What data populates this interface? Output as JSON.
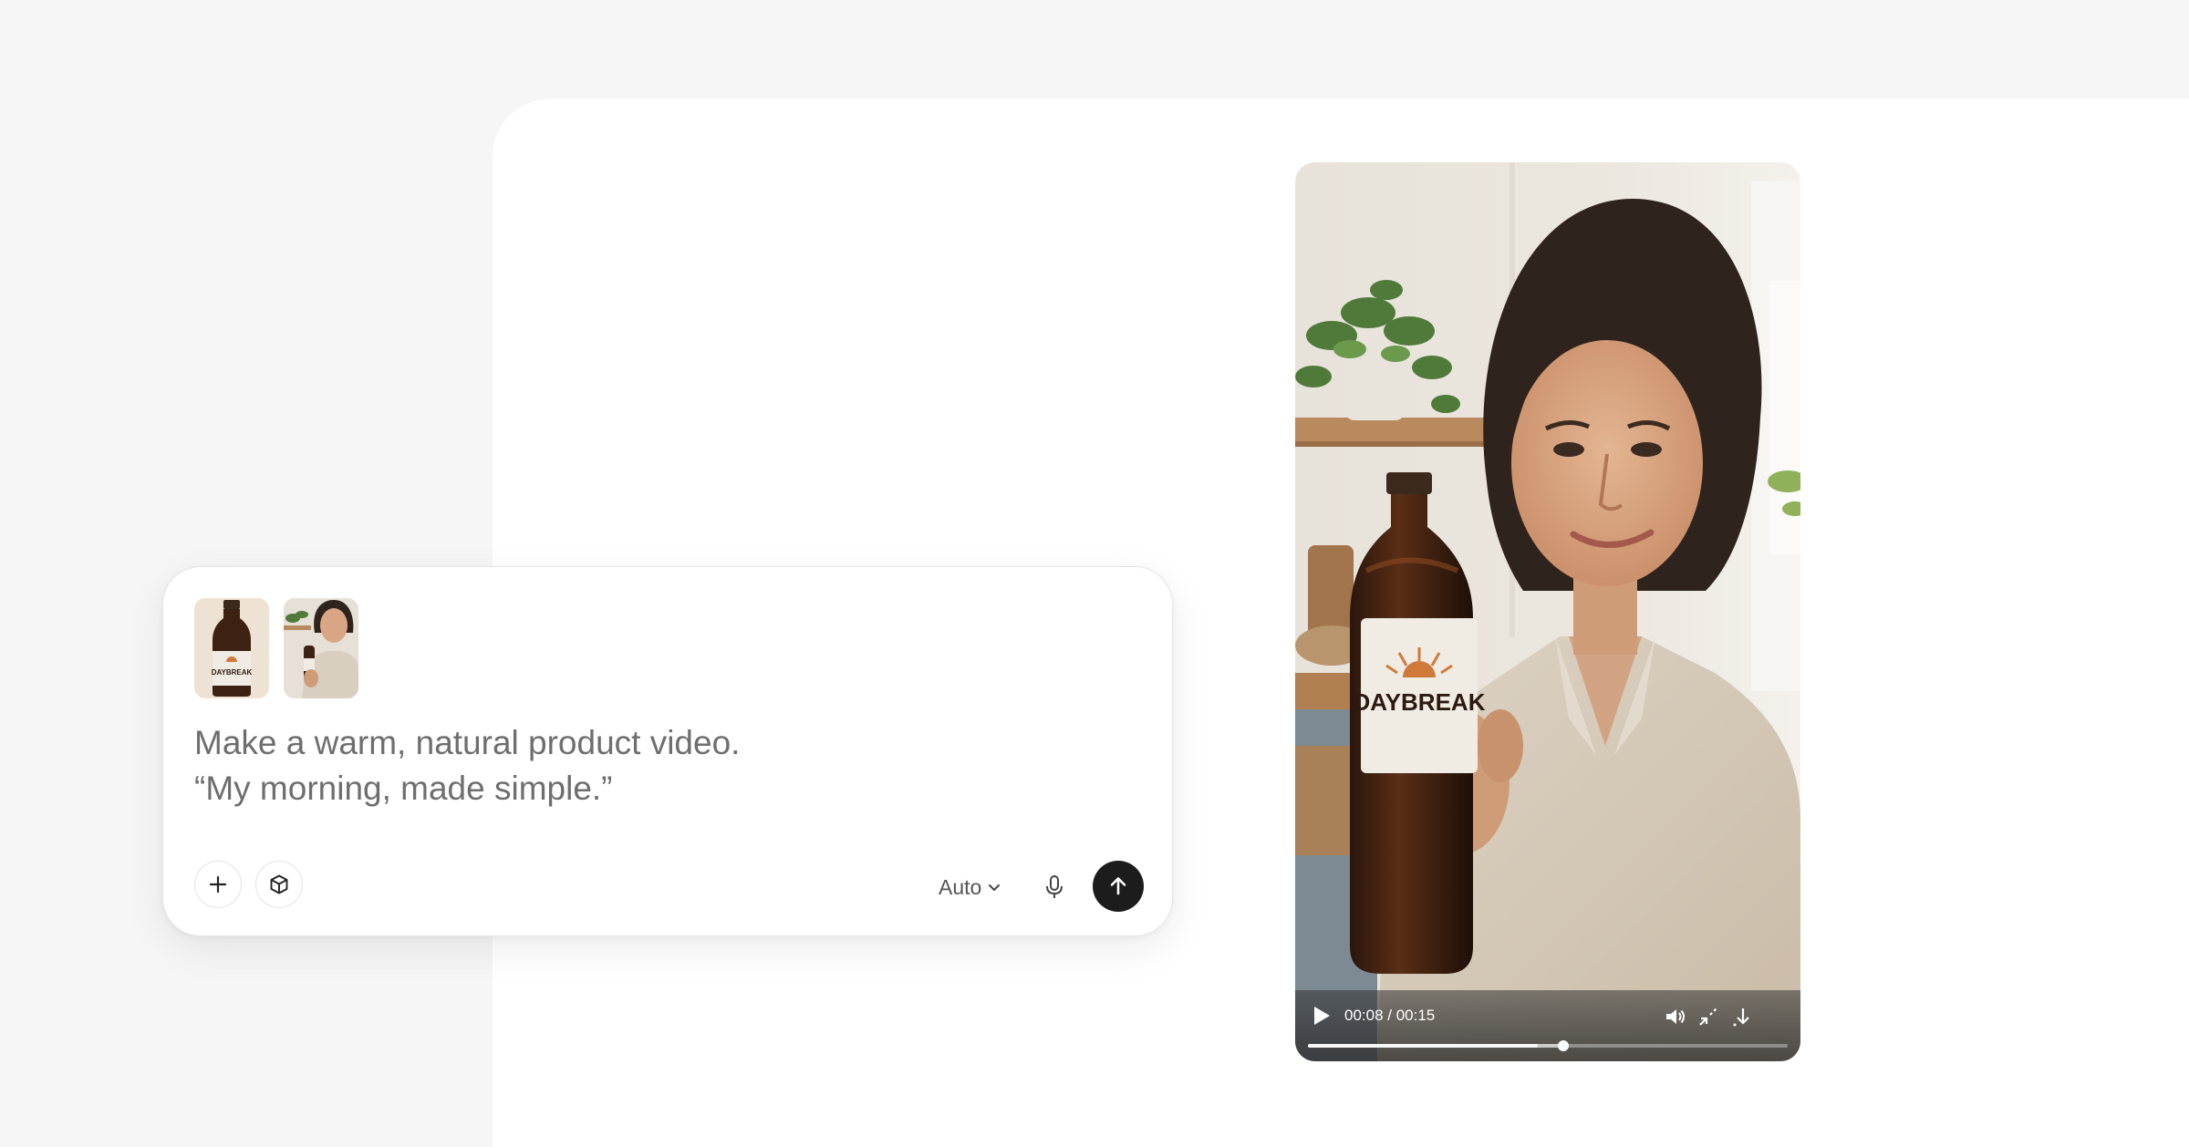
{
  "composer": {
    "attachments": [
      {
        "name": "bottle-thumbnail",
        "label": "DAYBREAK"
      },
      {
        "name": "woman-thumbnail",
        "label": ""
      }
    ],
    "prompt_lines": [
      "Make a warm, natural product video.",
      "“My morning, made simple.”"
    ],
    "mode": {
      "selected": "Auto"
    },
    "icons": {
      "add": "plus-icon",
      "object": "cube-icon",
      "dropdown": "chevron-down-icon",
      "mic": "microphone-icon",
      "send": "arrow-up-icon"
    }
  },
  "video": {
    "product_label": "DAYBREAK",
    "time": {
      "current": "00:08",
      "total": "00:15",
      "display": "00:08 / 00:15"
    },
    "progress": {
      "played_fraction": 0.533,
      "buffered_fraction": 0.48
    },
    "icons": {
      "play": "play-icon",
      "volume": "volume-icon",
      "exit_fullscreen": "collapse-icon",
      "download": "download-icon"
    }
  },
  "colors": {
    "page_background": "#f6f6f6",
    "panel_background": "#ffffff",
    "send_button": "#1c1c1c",
    "prompt_text": "#6e6e6e"
  }
}
